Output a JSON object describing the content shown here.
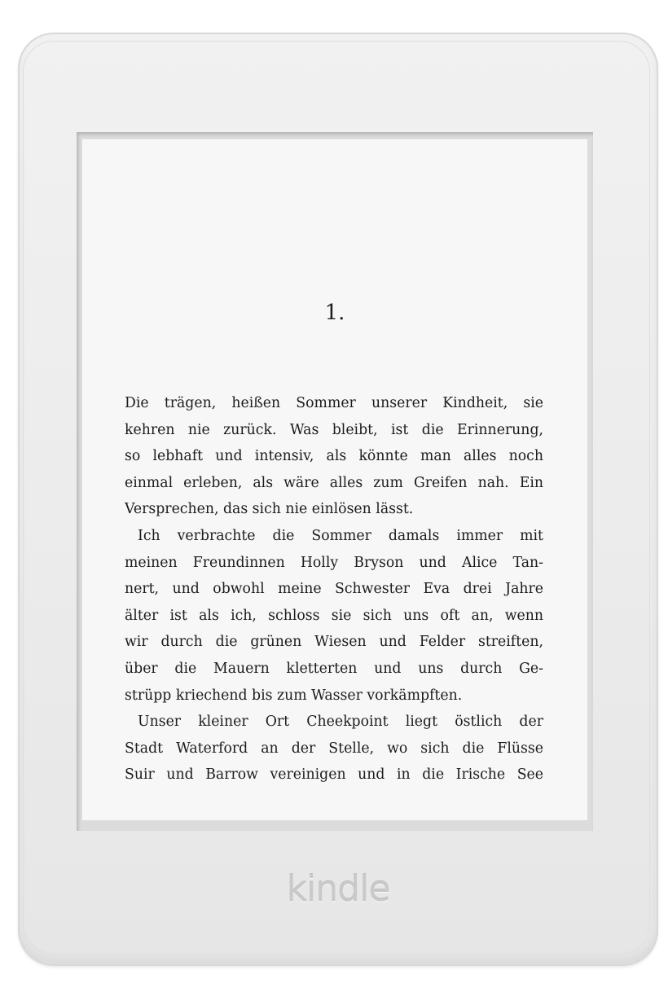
{
  "device": {
    "brand": "kindle"
  },
  "page": {
    "chapter": "1.",
    "lines": [
      "Die trägen, heißen Sommer unserer Kindheit, sie",
      "kehren nie zurück. Was bleibt, ist die Erinnerung,",
      "so lebhaft und intensiv, als könnte man alles noch",
      "einmal erleben, als wäre alles zum Greifen nah. Ein",
      "Versprechen, das sich nie einlösen lässt.",
      "Ich verbrachte die Sommer damals immer mit",
      "meinen Freundinnen Holly Bryson und Alice Tan-",
      "nert, und obwohl meine Schwester Eva drei Jahre",
      "älter ist als ich, schloss sie sich uns oft an, wenn",
      "wir durch die grünen Wiesen und Felder streiften,",
      "über die Mauern kletterten und uns durch Ge-",
      "strüpp kriechend bis zum Wasser vorkämpften.",
      "Unser kleiner Ort Cheekpoint liegt östlich der",
      "Stadt Waterford an der Stelle, wo sich die Flüsse",
      "Suir und Barrow vereinigen und in die Irische See"
    ]
  }
}
